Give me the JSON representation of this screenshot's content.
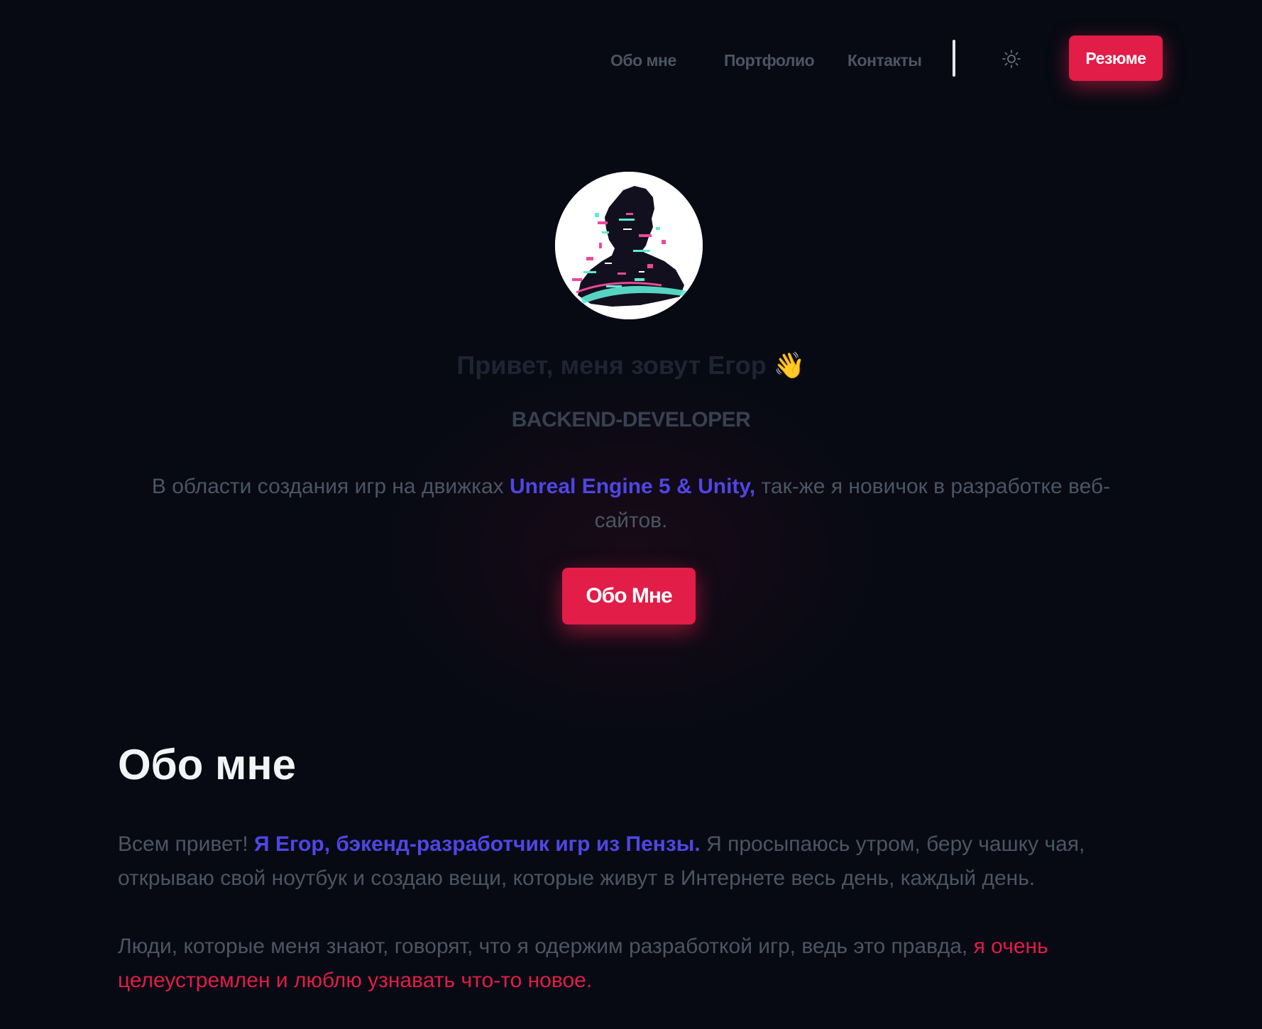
{
  "nav": {
    "items": [
      {
        "label": "Обо мне"
      },
      {
        "label": "Портфолио"
      },
      {
        "label": "Контакты"
      }
    ],
    "theme_icon": "sun-icon",
    "resume_label": "Резюме"
  },
  "hero": {
    "greeting": "Привет, меня зовут Егор",
    "wave_emoji": "👋",
    "role": "BACKEND-DEVELOPER",
    "description": {
      "before": "В области создания игр на движках ",
      "highlight": "Unreal Engine 5 & Unity,",
      "after": " так-же я новичок в разработке веб-сайтов."
    },
    "button_label": "Обо Мне"
  },
  "about": {
    "title": "Обо мне",
    "p1": {
      "before": "Всем привет! ",
      "highlight": "Я Егор, бэкенд-разработчик игр из Пензы.",
      "after": " Я просыпаюсь утром, беру чашку чая, открываю свой ноутбук и создаю вещи, которые живут в Интернете весь день, каждый день."
    },
    "p2": {
      "before": "Люди, которые меня знают, говорят, что я одержим разработкой игр, ведь это правда, ",
      "highlight": "я очень целеустремлен и люблю узнавать что-то новое."
    }
  },
  "colors": {
    "background": "#070a13",
    "accent": "#e11d48",
    "highlight": "#4f46e5",
    "muted_text": "#4b5563"
  }
}
